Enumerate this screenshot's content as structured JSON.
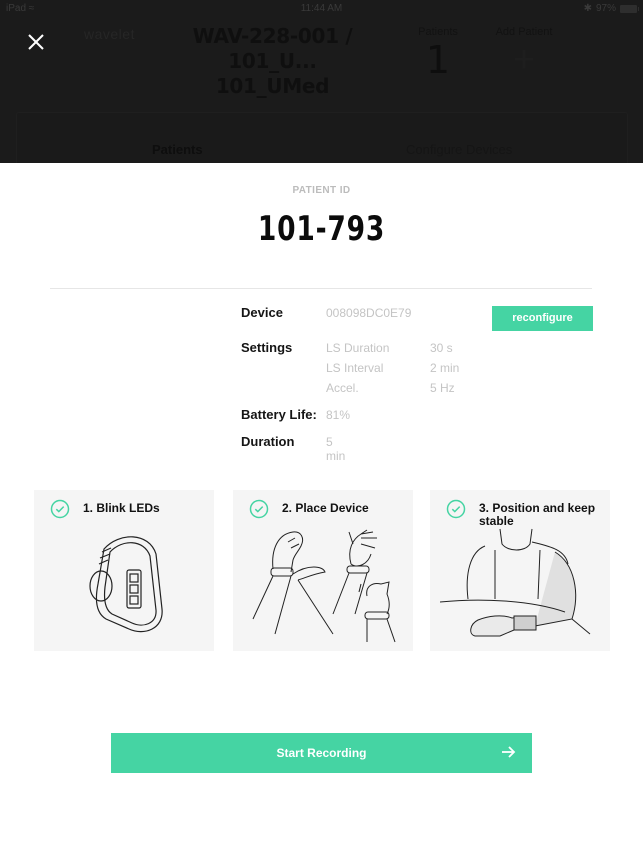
{
  "status_bar": {
    "device": "iPad",
    "time": "11:44 AM",
    "battery": "97%"
  },
  "background": {
    "logo": "wavelet",
    "title_line1": "WAV-228-001 / 101_U...",
    "title_line2": "101_UMed",
    "patients_label": "Patients",
    "patients_count": "1",
    "add_patient_label": "Add Patient",
    "add_patient_symbol": "+",
    "tabs": [
      {
        "label": "Patients"
      },
      {
        "label": "Configure Devices"
      }
    ]
  },
  "modal": {
    "patient_id_label": "PATIENT ID",
    "patient_id": "101-793",
    "device_label": "Device",
    "device_value": "008098DC0E79",
    "reconfigure_label": "reconfigure",
    "settings_label": "Settings",
    "settings": [
      {
        "key": "LS Duration",
        "value": "30 s"
      },
      {
        "key": "LS Interval",
        "value": "2 min"
      },
      {
        "key": "Accel.",
        "value": "5 Hz"
      }
    ],
    "battery_label": "Battery Life:",
    "battery_value": "81%",
    "duration_label": "Duration",
    "duration_value": "5 min",
    "steps": [
      {
        "title": "1. Blink LEDs",
        "icon": "check-circle-icon",
        "illustration": "wristband-illustration"
      },
      {
        "title": "2. Place Device",
        "icon": "check-circle-icon",
        "illustration": "place-device-illustration"
      },
      {
        "title": "3. Position and keep stable",
        "icon": "check-circle-icon",
        "illustration": "position-arm-illustration"
      }
    ],
    "start_label": "Start Recording",
    "start_icon": "arrow-right-icon"
  },
  "colors": {
    "accent": "#45d4a3",
    "backdrop": "#1b1b1b",
    "card_bg": "#f5f5f5",
    "muted_text": "#c4c4c4"
  }
}
